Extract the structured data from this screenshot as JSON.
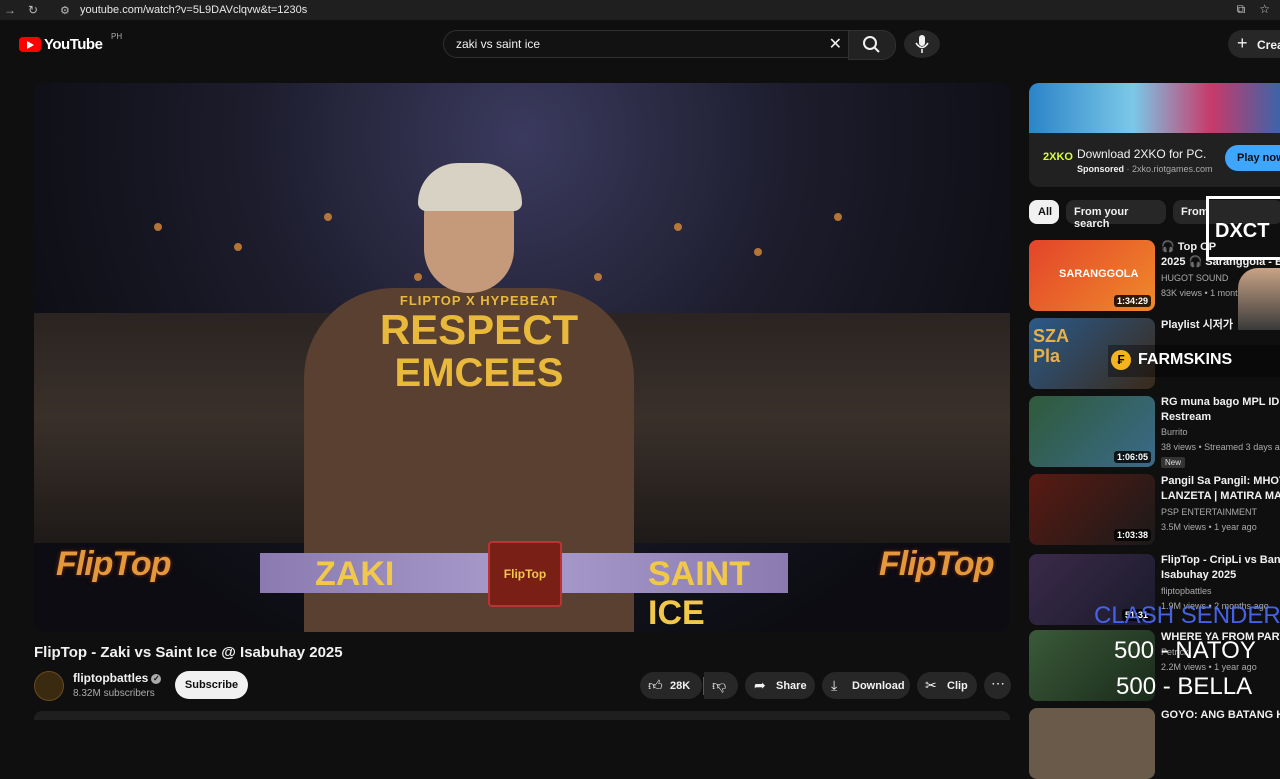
{
  "browser": {
    "url": "youtube.com/watch?v=5L9DAVclqvw&t=1230s"
  },
  "header": {
    "logo_text": "YouTube",
    "country_code": "PH",
    "search_query": "zaki vs saint ice",
    "create_label": "Crea"
  },
  "player": {
    "left_name": "ZAKI",
    "right_name": "SAINT ICE",
    "badge_text": "FlipTop",
    "logo_left": "FlipTop",
    "logo_right": "FlipTop",
    "shirt_line1": "FLIPTOP X HYPEBEAT",
    "shirt_line2": "RESPECT",
    "shirt_line3": "EMCEES"
  },
  "video": {
    "title": "FlipTop - Zaki vs Saint Ice @ Isabuhay 2025",
    "channel": "fliptopbattles",
    "subscribers": "8.32M subscribers",
    "subscribe_label": "Subscribe",
    "likes": "28K",
    "share_label": "Share",
    "download_label": "Download",
    "clip_label": "Clip"
  },
  "ad": {
    "title": "Download 2XKO for PC.",
    "sponsored": "Sponsored",
    "domain": "2xko.riotgames.com",
    "cta": "Play now",
    "logo_text": "2XKO"
  },
  "chips": [
    "All",
    "From your search",
    "From"
  ],
  "related": [
    {
      "title1": "🎧 Top OP",
      "title2": "2025 🎧 Saranggola - Be",
      "channel": "HUGOT SOUND",
      "meta": "83K views • 1 month",
      "duration": "1:34:29",
      "thumb_text": "SARANGGOLA"
    },
    {
      "title1": "Playlist 시저가",
      "title2": "",
      "channel": "",
      "meta": "",
      "duration": "",
      "thumb_text": "SZA Pla"
    },
    {
      "title1": "RG muna bago MPL ID",
      "title2": "Restream",
      "channel": "Burrito",
      "meta": "38 views • Streamed 3 days a",
      "duration": "1:06:05",
      "badge": "New"
    },
    {
      "title1": "Pangil Sa Pangil: MHOT v",
      "title2": "LANZETA | MATIRA MAYA",
      "channel": "PSP ENTERTAINMENT",
      "meta": "3.5M views • 1 year ago",
      "duration": "1:03:38"
    },
    {
      "title1": "FlipTop - CripLi vs Ban @",
      "title2": "Isabuhay 2025",
      "channel": "fliptopbattles",
      "meta": "1.9M views • 2 months ago",
      "duration": "51:31"
    },
    {
      "title1": "WHERE YA FROM PART 1",
      "title2": "",
      "channel": "Petrick",
      "meta": "2.2M views • 1 year ago",
      "duration": ""
    },
    {
      "title1": "GOYO: ANG BATANG HEN",
      "title2": "",
      "channel": "",
      "meta": "",
      "duration": ""
    }
  ],
  "stream_overlay": {
    "farmskins": "FARMSKINS",
    "dxct": "DXCT",
    "donation1": "CLASH SENDER",
    "donation2": "500 - NATOY",
    "donation3": "500  - BELLA"
  },
  "colors": {
    "accent_blue": "#3ea6ff",
    "youtube_red": "#ff0000",
    "background": "#0f0f0f"
  }
}
